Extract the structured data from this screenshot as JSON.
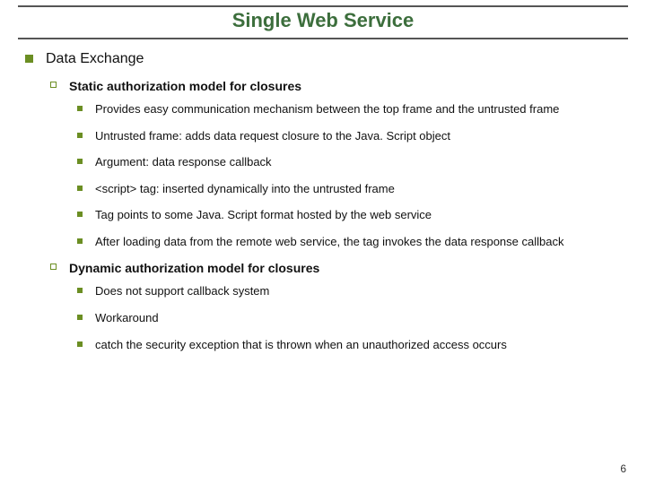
{
  "title": "Single Web Service",
  "pageNumber": "6",
  "outline": {
    "heading": "Data Exchange",
    "sections": [
      {
        "heading": "Static authorization model for closures",
        "items": [
          "Provides easy communication mechanism between the top frame and the untrusted frame",
          "Untrusted frame: adds data request closure to the Java. Script object",
          "Argument: data response callback",
          "<script> tag: inserted dynamically into the untrusted frame",
          "Tag points to some Java. Script format hosted by the web service",
          "After loading data from the remote web service, the tag invokes the data response callback"
        ]
      },
      {
        "heading": "Dynamic authorization model for closures",
        "items": [
          "Does not support callback system",
          "Workaround",
          "catch the security exception that is thrown when an unauthorized access occurs"
        ]
      }
    ]
  }
}
